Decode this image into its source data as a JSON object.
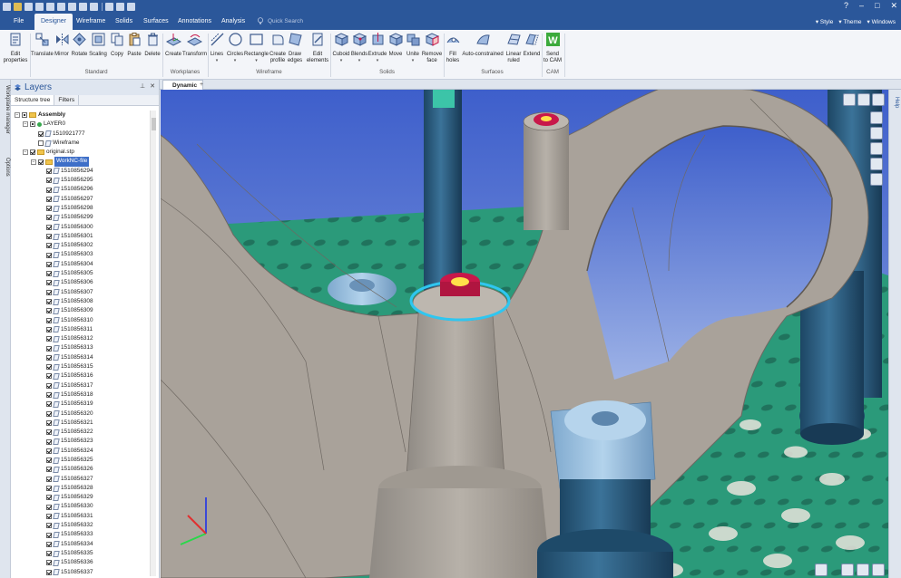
{
  "tabs": [
    {
      "label": "File"
    },
    {
      "label": "Designer",
      "active": true
    },
    {
      "label": "Wireframe"
    },
    {
      "label": "Solids"
    },
    {
      "label": "Surfaces"
    },
    {
      "label": "Annotations"
    },
    {
      "label": "Analysis"
    }
  ],
  "quick_search": {
    "placeholder": "Quick Search"
  },
  "right_menus": [
    "Style",
    "Theme",
    "Windows"
  ],
  "window_controls": [
    "?",
    "–",
    "□",
    "✕"
  ],
  "ribbon": {
    "groups": [
      {
        "label": "",
        "tools": [
          {
            "label": "Edit\nproperties",
            "icon": "edit-properties-icon"
          }
        ]
      },
      {
        "label": "Standard",
        "tools": [
          {
            "label": "Translate",
            "icon": "translate-icon"
          },
          {
            "label": "Mirror",
            "icon": "mirror-icon"
          },
          {
            "label": "Rotate",
            "icon": "rotate-icon"
          },
          {
            "label": "Scaling",
            "icon": "scaling-icon"
          },
          {
            "label": "Copy",
            "icon": "copy-icon"
          },
          {
            "label": "Paste",
            "icon": "paste-icon"
          },
          {
            "label": "Delete",
            "icon": "delete-icon"
          }
        ]
      },
      {
        "label": "Workplanes",
        "tools": [
          {
            "label": "Create",
            "icon": "create-workplane-icon"
          },
          {
            "label": "Transform",
            "icon": "transform-icon"
          }
        ]
      },
      {
        "label": "Wireframe",
        "tools": [
          {
            "label": "Lines",
            "icon": "lines-icon",
            "dropdown": true
          },
          {
            "label": "Circles",
            "icon": "circles-icon",
            "dropdown": true
          },
          {
            "label": "Rectangle",
            "icon": "rectangle-icon",
            "dropdown": true
          },
          {
            "label": "Create\nprofile",
            "icon": "create-profile-icon"
          },
          {
            "label": "Draw\nedges",
            "icon": "draw-edges-icon"
          },
          {
            "label": "Edit\nelements",
            "icon": "edit-elements-icon"
          }
        ]
      },
      {
        "label": "Solids",
        "tools": [
          {
            "label": "Cuboid",
            "icon": "cuboid-icon",
            "dropdown": true
          },
          {
            "label": "Blends",
            "icon": "blends-icon",
            "dropdown": true
          },
          {
            "label": "Extrude",
            "icon": "extrude-icon",
            "dropdown": true
          },
          {
            "label": "Move",
            "icon": "move-icon"
          },
          {
            "label": "Unite",
            "icon": "unite-icon",
            "dropdown": true
          },
          {
            "label": "Remove\nface",
            "icon": "remove-face-icon"
          }
        ]
      },
      {
        "label": "Surfaces",
        "tools": [
          {
            "label": "Fill\nholes",
            "icon": "fill-holes-icon"
          },
          {
            "label": "Auto-constrained",
            "icon": "auto-constrained-icon"
          },
          {
            "label": "Linear\nruled",
            "icon": "linear-ruled-icon"
          },
          {
            "label": "Extend",
            "icon": "extend-icon"
          }
        ]
      },
      {
        "label": "CAM",
        "tools": [
          {
            "label": "Send\nto CAM",
            "icon": "send-to-cam-icon"
          }
        ]
      }
    ]
  },
  "side_strip": {
    "workplane_manager": "Workplane manager",
    "options": "Options"
  },
  "layers": {
    "title": "Layers",
    "tabs": [
      "Structure tree",
      "Filters"
    ],
    "tree": [
      {
        "level": 0,
        "label": "Assembly",
        "bold": true,
        "expander": "−",
        "check": "sq",
        "icon": "folder"
      },
      {
        "level": 1,
        "label": "LAYER0",
        "expander": "−",
        "check": "sq",
        "icon": "dot"
      },
      {
        "level": 2,
        "label": "1510921777",
        "check": "on",
        "icon": "doc"
      },
      {
        "level": 2,
        "label": "Wireframe",
        "check": "off",
        "icon": "grid"
      },
      {
        "level": 1,
        "label": "original.stp",
        "expander": "−",
        "check": "on",
        "icon": "folder"
      },
      {
        "level": 2,
        "label": "WorkNC-file",
        "selected": true,
        "expander": "−",
        "check": "on",
        "icon": "folder"
      },
      {
        "level": 3,
        "label": "1510856294",
        "check": "on",
        "icon": "doc"
      },
      {
        "level": 3,
        "label": "1510856295",
        "check": "on",
        "icon": "doc"
      },
      {
        "level": 3,
        "label": "1510856296",
        "check": "on",
        "icon": "doc"
      },
      {
        "level": 3,
        "label": "1510856297",
        "check": "on",
        "icon": "doc"
      },
      {
        "level": 3,
        "label": "1510856298",
        "check": "on",
        "icon": "doc"
      },
      {
        "level": 3,
        "label": "1510856299",
        "check": "on",
        "icon": "doc"
      },
      {
        "level": 3,
        "label": "1510856300",
        "check": "on",
        "icon": "doc"
      },
      {
        "level": 3,
        "label": "1510856301",
        "check": "on",
        "icon": "doc"
      },
      {
        "level": 3,
        "label": "1510856302",
        "check": "on",
        "icon": "doc"
      },
      {
        "level": 3,
        "label": "1510856303",
        "check": "on",
        "icon": "doc"
      },
      {
        "level": 3,
        "label": "1510856304",
        "check": "on",
        "icon": "doc"
      },
      {
        "level": 3,
        "label": "1510856305",
        "check": "on",
        "icon": "doc"
      },
      {
        "level": 3,
        "label": "1510856306",
        "check": "on",
        "icon": "doc"
      },
      {
        "level": 3,
        "label": "1510856307",
        "check": "on",
        "icon": "doc"
      },
      {
        "level": 3,
        "label": "1510856308",
        "check": "on",
        "icon": "doc"
      },
      {
        "level": 3,
        "label": "1510856309",
        "check": "on",
        "icon": "doc"
      },
      {
        "level": 3,
        "label": "1510856310",
        "check": "on",
        "icon": "doc"
      },
      {
        "level": 3,
        "label": "1510856311",
        "check": "on",
        "icon": "doc"
      },
      {
        "level": 3,
        "label": "1510856312",
        "check": "on",
        "icon": "doc"
      },
      {
        "level": 3,
        "label": "1510856313",
        "check": "on",
        "icon": "doc"
      },
      {
        "level": 3,
        "label": "1510856314",
        "check": "on",
        "icon": "doc"
      },
      {
        "level": 3,
        "label": "1510856315",
        "check": "on",
        "icon": "doc"
      },
      {
        "level": 3,
        "label": "1510856316",
        "check": "on",
        "icon": "doc"
      },
      {
        "level": 3,
        "label": "1510856317",
        "check": "on",
        "icon": "doc"
      },
      {
        "level": 3,
        "label": "1510856318",
        "check": "on",
        "icon": "doc"
      },
      {
        "level": 3,
        "label": "1510856319",
        "check": "on",
        "icon": "doc"
      },
      {
        "level": 3,
        "label": "1510856320",
        "check": "on",
        "icon": "doc"
      },
      {
        "level": 3,
        "label": "1510856321",
        "check": "on",
        "icon": "doc"
      },
      {
        "level": 3,
        "label": "1510856322",
        "check": "on",
        "icon": "doc"
      },
      {
        "level": 3,
        "label": "1510856323",
        "check": "on",
        "icon": "doc"
      },
      {
        "level": 3,
        "label": "1510856324",
        "check": "on",
        "icon": "doc"
      },
      {
        "level": 3,
        "label": "1510856325",
        "check": "on",
        "icon": "doc"
      },
      {
        "level": 3,
        "label": "1510856326",
        "check": "on",
        "icon": "doc"
      },
      {
        "level": 3,
        "label": "1510856327",
        "check": "on",
        "icon": "doc"
      },
      {
        "level": 3,
        "label": "1510856328",
        "check": "on",
        "icon": "doc"
      },
      {
        "level": 3,
        "label": "1510856329",
        "check": "on",
        "icon": "doc"
      },
      {
        "level": 3,
        "label": "1510856330",
        "check": "on",
        "icon": "doc"
      },
      {
        "level": 3,
        "label": "1510856331",
        "check": "on",
        "icon": "doc"
      },
      {
        "level": 3,
        "label": "1510856332",
        "check": "on",
        "icon": "doc"
      },
      {
        "level": 3,
        "label": "1510856333",
        "check": "on",
        "icon": "doc"
      },
      {
        "level": 3,
        "label": "1510856334",
        "check": "on",
        "icon": "doc"
      },
      {
        "level": 3,
        "label": "1510856335",
        "check": "on",
        "icon": "doc"
      },
      {
        "level": 3,
        "label": "1510856336",
        "check": "on",
        "icon": "doc"
      },
      {
        "level": 3,
        "label": "1510856337",
        "check": "on",
        "icon": "doc"
      }
    ]
  },
  "document_tab": {
    "label": "Dynamic",
    "add": "+"
  },
  "help_label": "Help",
  "colors": {
    "title_bar": "#2b579a",
    "viewport_sky_top": "#4a6ad0",
    "viewport_sky_bottom": "#8fa6e3",
    "fixture_plate": "#2b9a7a",
    "part_gray": "#a9a29a",
    "blue_pillar": "#2c5f82",
    "light_blue_clamp": "#9dc3e0",
    "red_bushing": "#c8184a",
    "selection_cyan": "#2fc6f0"
  }
}
